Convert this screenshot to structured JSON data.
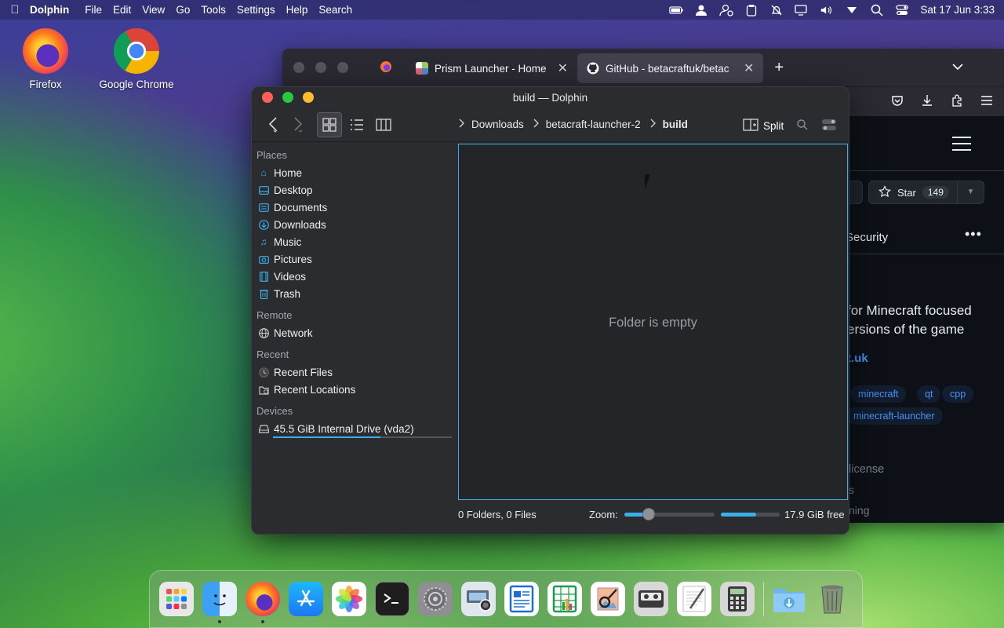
{
  "menubar": {
    "app_name": "Dolphin",
    "items": [
      "File",
      "Edit",
      "View",
      "Go",
      "Tools",
      "Settings",
      "Help",
      "Search"
    ],
    "clock": "Sat 17 Jun 3:33"
  },
  "desktop": {
    "icons": [
      {
        "label": "Firefox",
        "icon": "firefox-icon"
      },
      {
        "label": "Google Chrome",
        "icon": "chrome-icon"
      }
    ]
  },
  "firefox": {
    "tabs": [
      {
        "label": "Prism Launcher - Home",
        "icon": "prism-icon"
      },
      {
        "label": "GitHub - betacraftuk/betac",
        "icon": "github-icon"
      }
    ],
    "new_tab": "+",
    "github": {
      "star_label": "Star",
      "star_count": "149",
      "nav_security": "Security",
      "description_line1": "for Minecraft focused",
      "description_line2": "ersions of the game",
      "link": "t.uk",
      "topics": [
        "minecraft",
        "qt",
        "cpp",
        "minecraft-launcher"
      ],
      "license": "license",
      "misc1": "s",
      "misc2": "ning"
    }
  },
  "dolphin": {
    "title": "build — Dolphin",
    "breadcrumbs": [
      "Downloads",
      "betacraft-launcher-2",
      "build"
    ],
    "split_label": "Split",
    "places": {
      "places_header": "Places",
      "places_items": [
        {
          "label": "Home",
          "icon": "home-icon"
        },
        {
          "label": "Desktop",
          "icon": "desktop-icon"
        },
        {
          "label": "Documents",
          "icon": "documents-icon"
        },
        {
          "label": "Downloads",
          "icon": "downloads-icon"
        },
        {
          "label": "Music",
          "icon": "music-icon"
        },
        {
          "label": "Pictures",
          "icon": "pictures-icon"
        },
        {
          "label": "Videos",
          "icon": "videos-icon"
        },
        {
          "label": "Trash",
          "icon": "trash-icon"
        }
      ],
      "remote_header": "Remote",
      "remote_items": [
        {
          "label": "Network",
          "icon": "network-icon"
        }
      ],
      "recent_header": "Recent",
      "recent_items": [
        {
          "label": "Recent Files",
          "icon": "recent-files-icon"
        },
        {
          "label": "Recent Locations",
          "icon": "recent-locations-icon"
        }
      ],
      "devices_header": "Devices",
      "device_label": "45.5 GiB Internal Drive (vda2)",
      "device_used_fraction": 0.6
    },
    "empty_message": "Folder is empty",
    "status": {
      "counts": "0 Folders, 0 Files",
      "zoom_label": "Zoom:",
      "free_space": "17.9 GiB free",
      "free_fraction": 0.6
    }
  },
  "dock": {
    "items": [
      "launchpad-icon",
      "finder-icon",
      "firefox-icon",
      "app-store-icon",
      "photos-icon",
      "terminal-icon",
      "system-settings-icon",
      "image-capture-icon",
      "pages-icon",
      "numbers-icon",
      "preview-icon",
      "cassette-icon",
      "textedit-icon",
      "calculator-icon",
      "downloads-folder-icon",
      "trash-icon"
    ]
  },
  "colors": {
    "accent": "#3daee9",
    "close": "#ff5f57",
    "minimize": "#28c840",
    "zoom": "#febc2e",
    "github_link": "#4493f8"
  }
}
